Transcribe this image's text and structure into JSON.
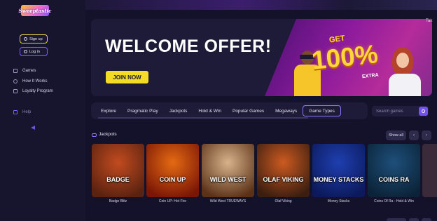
{
  "brand": {
    "logo_text": "Sweeptastic"
  },
  "sidebar": {
    "signup_label": "Sign up",
    "login_label": "Log in",
    "items": [
      {
        "label": "Games",
        "icon": "grid-icon"
      },
      {
        "label": "How It Works",
        "icon": "info-icon"
      },
      {
        "label": "Loyalty Program",
        "icon": "crown-icon"
      }
    ],
    "help_label": "Help"
  },
  "hero": {
    "title": "WELCOME OFFER!",
    "cta": "JOIN NOW",
    "get": "GET",
    "percent": "100%",
    "extra": "EXTRA"
  },
  "tabs": [
    "Explore",
    "Pragmatic Play",
    "Jackpots",
    "Hold & Win",
    "Popular Games",
    "Megaways",
    "Game Types"
  ],
  "active_tab": "Game Types",
  "search": {
    "placeholder": "Search games"
  },
  "section": {
    "title": "Jackpots",
    "show_all": "Show all"
  },
  "games": [
    {
      "name": "Badge Blitz",
      "logo": "BADGE",
      "color1": "#c24b1f",
      "color2": "#5a2210"
    },
    {
      "name": "Coin UP: Hot Fire",
      "logo": "COIN UP",
      "color1": "#e46a12",
      "color2": "#7a1606"
    },
    {
      "name": "Wild West TRUEWAYS",
      "logo": "WILD WEST",
      "color1": "#d7b28a",
      "color2": "#5b3218"
    },
    {
      "name": "Olaf Viking",
      "logo": "OLAF VIKING",
      "color1": "#cc5a20",
      "color2": "#3b1e10"
    },
    {
      "name": "Money Stacks",
      "logo": "MONEY STACKS",
      "color1": "#1f3fb0",
      "color2": "#0c1a5c"
    },
    {
      "name": "Coins Of Ra - Hold & Win",
      "logo": "COINS RA",
      "color1": "#1e4f7a",
      "color2": "#0b2338"
    }
  ],
  "colors": {
    "accent": "#7452f0",
    "cta": "#f4dc26",
    "bg": "#14112a",
    "panel": "#1e1b38"
  },
  "right_edge_text": "Tak"
}
